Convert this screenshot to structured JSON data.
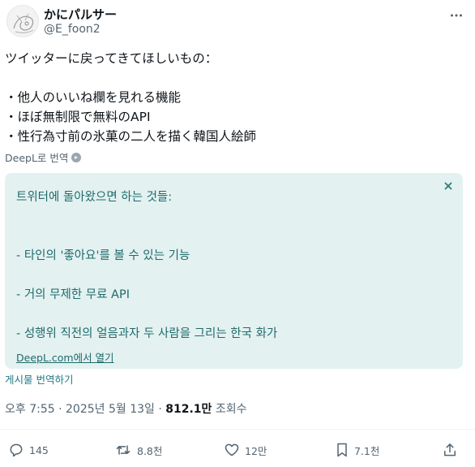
{
  "author": {
    "display_name": "かにパルサー",
    "handle": "@E_foon2"
  },
  "tweet": {
    "text": "ツイッターに戻ってきてほしいもの：\n\n・他人のいいね欄を見れる機能\n・ほぼ無制限で無料のAPI\n・性行為寸前の氷菓の二人を描く韓国人絵師",
    "deepl_label": "DeepL로 번역"
  },
  "translation": {
    "text": "트위터에 돌아왔으면 하는 것들:\n\n\n- 타인의 '좋아요'를 볼 수 있는 기능\n\n- 거의 무제한 무료 API\n\n- 성행위 직전의 얼음과자 두 사람을 그리는 한국 화가",
    "open_link": "DeepL.com에서 열기"
  },
  "translate_post_label": "게시물 번역하기",
  "meta": {
    "time_date": "오후 7:55 · 2025년 5월 13일 · ",
    "views_count": "812.1만",
    "views_label": " 조회수"
  },
  "actions": {
    "replies": "145",
    "reposts": "8.8천",
    "likes": "12만",
    "bookmarks": "7.1천"
  },
  "colors": {
    "translation_bg": "#e4f1f1",
    "translation_text": "#1e6b6b",
    "muted": "#536471"
  }
}
